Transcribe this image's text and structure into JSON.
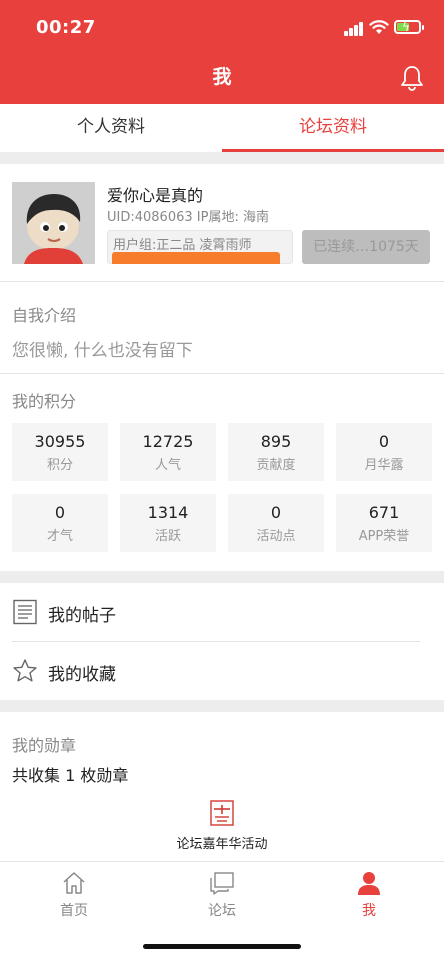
{
  "status_bar": {
    "time": "00:27"
  },
  "header": {
    "title": "我"
  },
  "tabs": [
    {
      "label": "个人资料",
      "active": false
    },
    {
      "label": "论坛资料",
      "active": true
    }
  ],
  "profile": {
    "username": "爱你心是真的",
    "uid_line": "UID:4086063  IP属地: 海南",
    "group_line": "用户组:正二品   凌霄雨师",
    "streak": "已连续…1075天"
  },
  "intro": {
    "title": "自我介绍",
    "text": "您很懒, 什么也没有留下"
  },
  "points": {
    "title": "我的积分",
    "items": [
      {
        "value": "30955",
        "label": "积分"
      },
      {
        "value": "12725",
        "label": "人气"
      },
      {
        "value": "895",
        "label": "贡献度"
      },
      {
        "value": "0",
        "label": "月华露"
      },
      {
        "value": "0",
        "label": "才气"
      },
      {
        "value": "1314",
        "label": "活跃"
      },
      {
        "value": "0",
        "label": "活动点"
      },
      {
        "value": "671",
        "label": "APP荣誉"
      }
    ]
  },
  "menu": {
    "my_posts": "我的帖子",
    "my_favorites": "我的收藏"
  },
  "medals": {
    "title": "我的勋章",
    "count_text": "共收集 1 枚勋章",
    "medal_name": "论坛嘉年华活动"
  },
  "bottom_nav": [
    {
      "label": "首页",
      "icon": "home-icon",
      "active": false
    },
    {
      "label": "论坛",
      "icon": "forum-icon",
      "active": false
    },
    {
      "label": "我",
      "icon": "profile-icon",
      "active": true
    }
  ],
  "colors": {
    "brand": "#e8403d",
    "progress": "#f57d2b",
    "battery": "#7ddc4a"
  }
}
